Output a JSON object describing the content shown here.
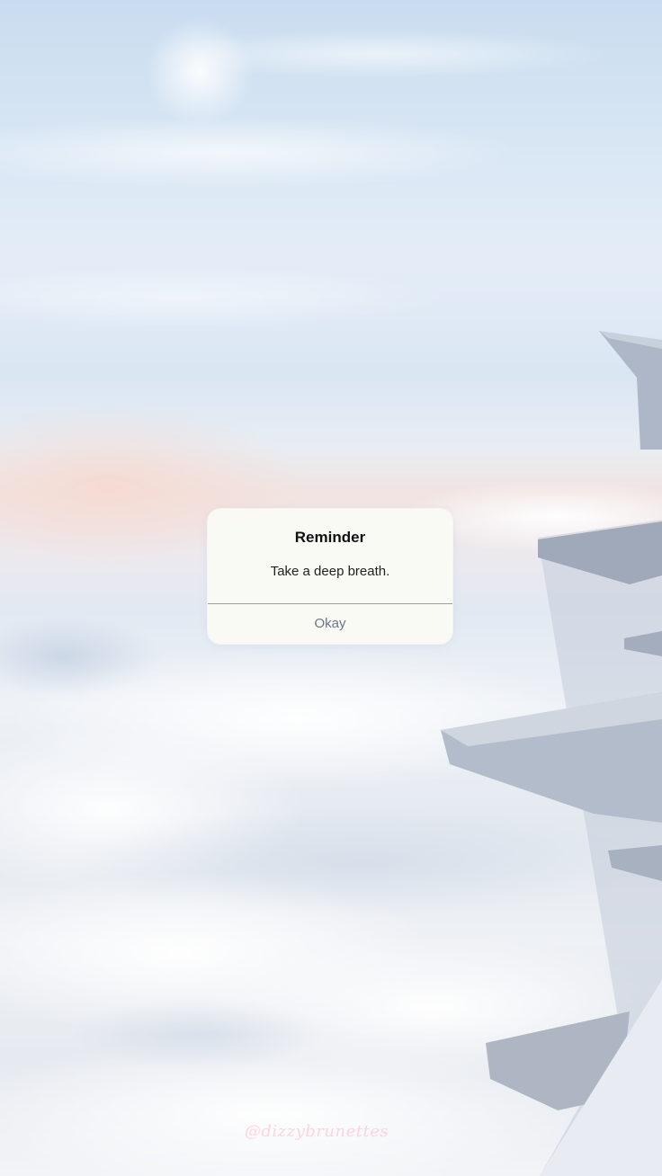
{
  "alert": {
    "title": "Reminder",
    "message": "Take a deep breath.",
    "button_label": "Okay"
  },
  "watermark": "@dizzybrunettes",
  "colors": {
    "sky_top": "#c9dcef",
    "sunset_glow": "#f1e4e1",
    "clouds": "#eef1f5",
    "alert_background": "#fafaf4",
    "button_text": "#6b7585",
    "watermark": "#ffcdd7"
  }
}
